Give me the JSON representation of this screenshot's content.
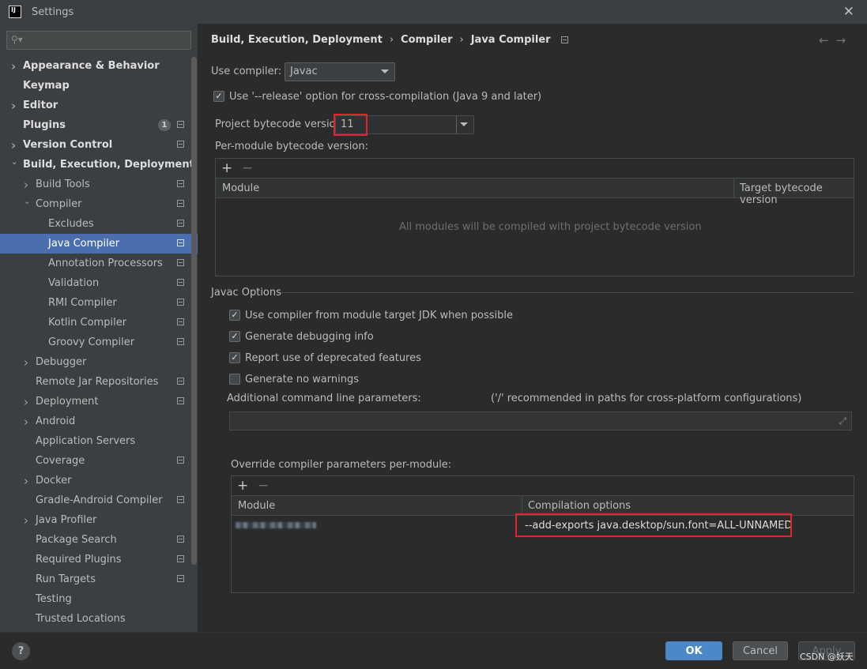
{
  "window": {
    "title": "Settings",
    "logo": "IJ"
  },
  "sidebar": {
    "search_placeholder": "",
    "items": [
      {
        "label": "Appearance & Behavior",
        "bold": true,
        "arrow": "›",
        "indent": 0
      },
      {
        "label": "Keymap",
        "bold": true,
        "arrow": "",
        "indent": 0
      },
      {
        "label": "Editor",
        "bold": true,
        "arrow": "›",
        "indent": 0
      },
      {
        "label": "Plugins",
        "bold": true,
        "arrow": "",
        "indent": 0,
        "badge": "1",
        "proj": true
      },
      {
        "label": "Version Control",
        "bold": true,
        "arrow": "›",
        "indent": 0,
        "proj": true
      },
      {
        "label": "Build, Execution, Deployment",
        "bold": true,
        "arrow": "⌄",
        "indent": 0
      },
      {
        "label": "Build Tools",
        "arrow": "›",
        "indent": 1,
        "proj": true
      },
      {
        "label": "Compiler",
        "arrow": "⌄",
        "indent": 1,
        "proj": true
      },
      {
        "label": "Excludes",
        "arrow": "",
        "indent": 2,
        "proj": true
      },
      {
        "label": "Java Compiler",
        "arrow": "",
        "indent": 2,
        "proj": true,
        "selected": true
      },
      {
        "label": "Annotation Processors",
        "arrow": "",
        "indent": 2,
        "proj": true
      },
      {
        "label": "Validation",
        "arrow": "",
        "indent": 2,
        "proj": true
      },
      {
        "label": "RMI Compiler",
        "arrow": "",
        "indent": 2,
        "proj": true
      },
      {
        "label": "Kotlin Compiler",
        "arrow": "",
        "indent": 2,
        "proj": true
      },
      {
        "label": "Groovy Compiler",
        "arrow": "",
        "indent": 2,
        "proj": true
      },
      {
        "label": "Debugger",
        "arrow": "›",
        "indent": 1
      },
      {
        "label": "Remote Jar Repositories",
        "arrow": "",
        "indent": 1,
        "proj": true
      },
      {
        "label": "Deployment",
        "arrow": "›",
        "indent": 1,
        "proj": true
      },
      {
        "label": "Android",
        "arrow": "›",
        "indent": 1
      },
      {
        "label": "Application Servers",
        "arrow": "",
        "indent": 1
      },
      {
        "label": "Coverage",
        "arrow": "",
        "indent": 1,
        "proj": true
      },
      {
        "label": "Docker",
        "arrow": "›",
        "indent": 1
      },
      {
        "label": "Gradle-Android Compiler",
        "arrow": "",
        "indent": 1,
        "proj": true
      },
      {
        "label": "Java Profiler",
        "arrow": "›",
        "indent": 1
      },
      {
        "label": "Package Search",
        "arrow": "",
        "indent": 1,
        "proj": true
      },
      {
        "label": "Required Plugins",
        "arrow": "",
        "indent": 1,
        "proj": true
      },
      {
        "label": "Run Targets",
        "arrow": "",
        "indent": 1,
        "proj": true
      },
      {
        "label": "Testing",
        "arrow": "",
        "indent": 1
      },
      {
        "label": "Trusted Locations",
        "arrow": "",
        "indent": 1
      }
    ]
  },
  "breadcrumb": {
    "part1": "Build, Execution, Deployment",
    "part2": "Compiler",
    "part3": "Java Compiler",
    "sep": "›"
  },
  "nav": {
    "back": "←",
    "forward": "→"
  },
  "main": {
    "use_compiler_label": "Use compiler:",
    "use_compiler_value": "Javac",
    "release_option_label": "Use '--release' option for cross-compilation (Java 9 and later)",
    "release_option_checked": true,
    "bytecode_label": "Project bytecode version:",
    "bytecode_value": "11",
    "per_module_label": "Per-module bytecode version:",
    "per_module_table": {
      "add": "+",
      "remove": "−",
      "col_module": "Module",
      "col_target": "Target bytecode version",
      "empty_text": "All modules will be compiled with project bytecode version"
    },
    "javac_options_title": "Javac Options",
    "options": [
      {
        "label": "Use compiler from module target JDK when possible",
        "checked": true
      },
      {
        "label": "Generate debugging info",
        "checked": true
      },
      {
        "label": "Report use of deprecated features",
        "checked": true
      },
      {
        "label": "Generate no warnings",
        "checked": false
      }
    ],
    "additional_params_label": "Additional command line parameters:",
    "additional_params_hint": "('/' recommended in paths for cross-platform configurations)",
    "additional_params_value": "",
    "override_label": "Override compiler parameters per-module:",
    "override_table": {
      "add": "+",
      "remove": "−",
      "col_module": "Module",
      "col_options": "Compilation options",
      "rows": [
        {
          "options": "--add-exports java.desktop/sun.font=ALL-UNNAMED"
        }
      ]
    }
  },
  "footer": {
    "help": "?",
    "ok": "OK",
    "cancel": "Cancel",
    "apply": "Apply",
    "watermark": "CSDN @妖天"
  },
  "colors": {
    "accent": "#4b6eaf",
    "ok_button": "#4a88c7",
    "highlight_box": "#e0262b"
  }
}
